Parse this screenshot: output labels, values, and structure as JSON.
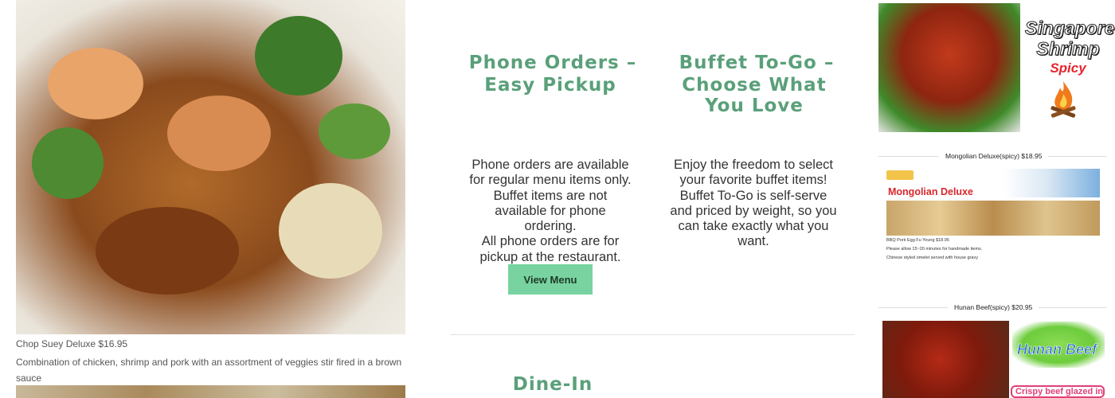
{
  "left": {
    "caption_title": "Chop Suey Deluxe $16.95",
    "caption_desc": "Combination of chicken, shrimp and pork  with an assortment of veggies stir fired in a brown sauce"
  },
  "middle": {
    "phone": {
      "icon": "phone-icon",
      "icon_glyph": "",
      "title": "Phone Orders – Easy Pickup",
      "body": "Phone orders are available for regular menu items only. Buffet items are not available for phone ordering.",
      "body2": "All phone orders are for pickup at the restaurant.",
      "button": "View Menu"
    },
    "buffet": {
      "icon": "utensils-icon",
      "icon_glyph": "",
      "title": "Buffet To-Go – Choose What You Love",
      "body": "Enjoy the freedom to select your favorite buffet items! Buffet To-Go is self-serve and priced by weight, so you can take exactly what you want."
    },
    "dine": {
      "icon": "chair-icon",
      "icon_glyph": "",
      "title": "Dine-In Options"
    }
  },
  "right": {
    "shrimp_title_1": "Singapore",
    "shrimp_title_2": "Shrimp",
    "shrimp_spicy": "Spicy",
    "mongolian_caption": "Mongolian Deluxe(spicy) $18.95",
    "mongolian_banner": "Mongolian Deluxe",
    "tiny_1": "BBQ Pork Egg Fu Young $18.95",
    "tiny_2": "Please allow 15~20 minutes for handmade items.",
    "tiny_3": "Chinese styled omelet served with house gravy",
    "hunan_caption": "Hunan Beef(spicy) $20.95",
    "hunan_title": "Hunan Beef",
    "crispy_tag": "Crispy beef glazed in"
  },
  "colors": {
    "heading_green": "#5aa07a",
    "button_green": "#78d3a0",
    "spicy_red": "#e5252e"
  }
}
